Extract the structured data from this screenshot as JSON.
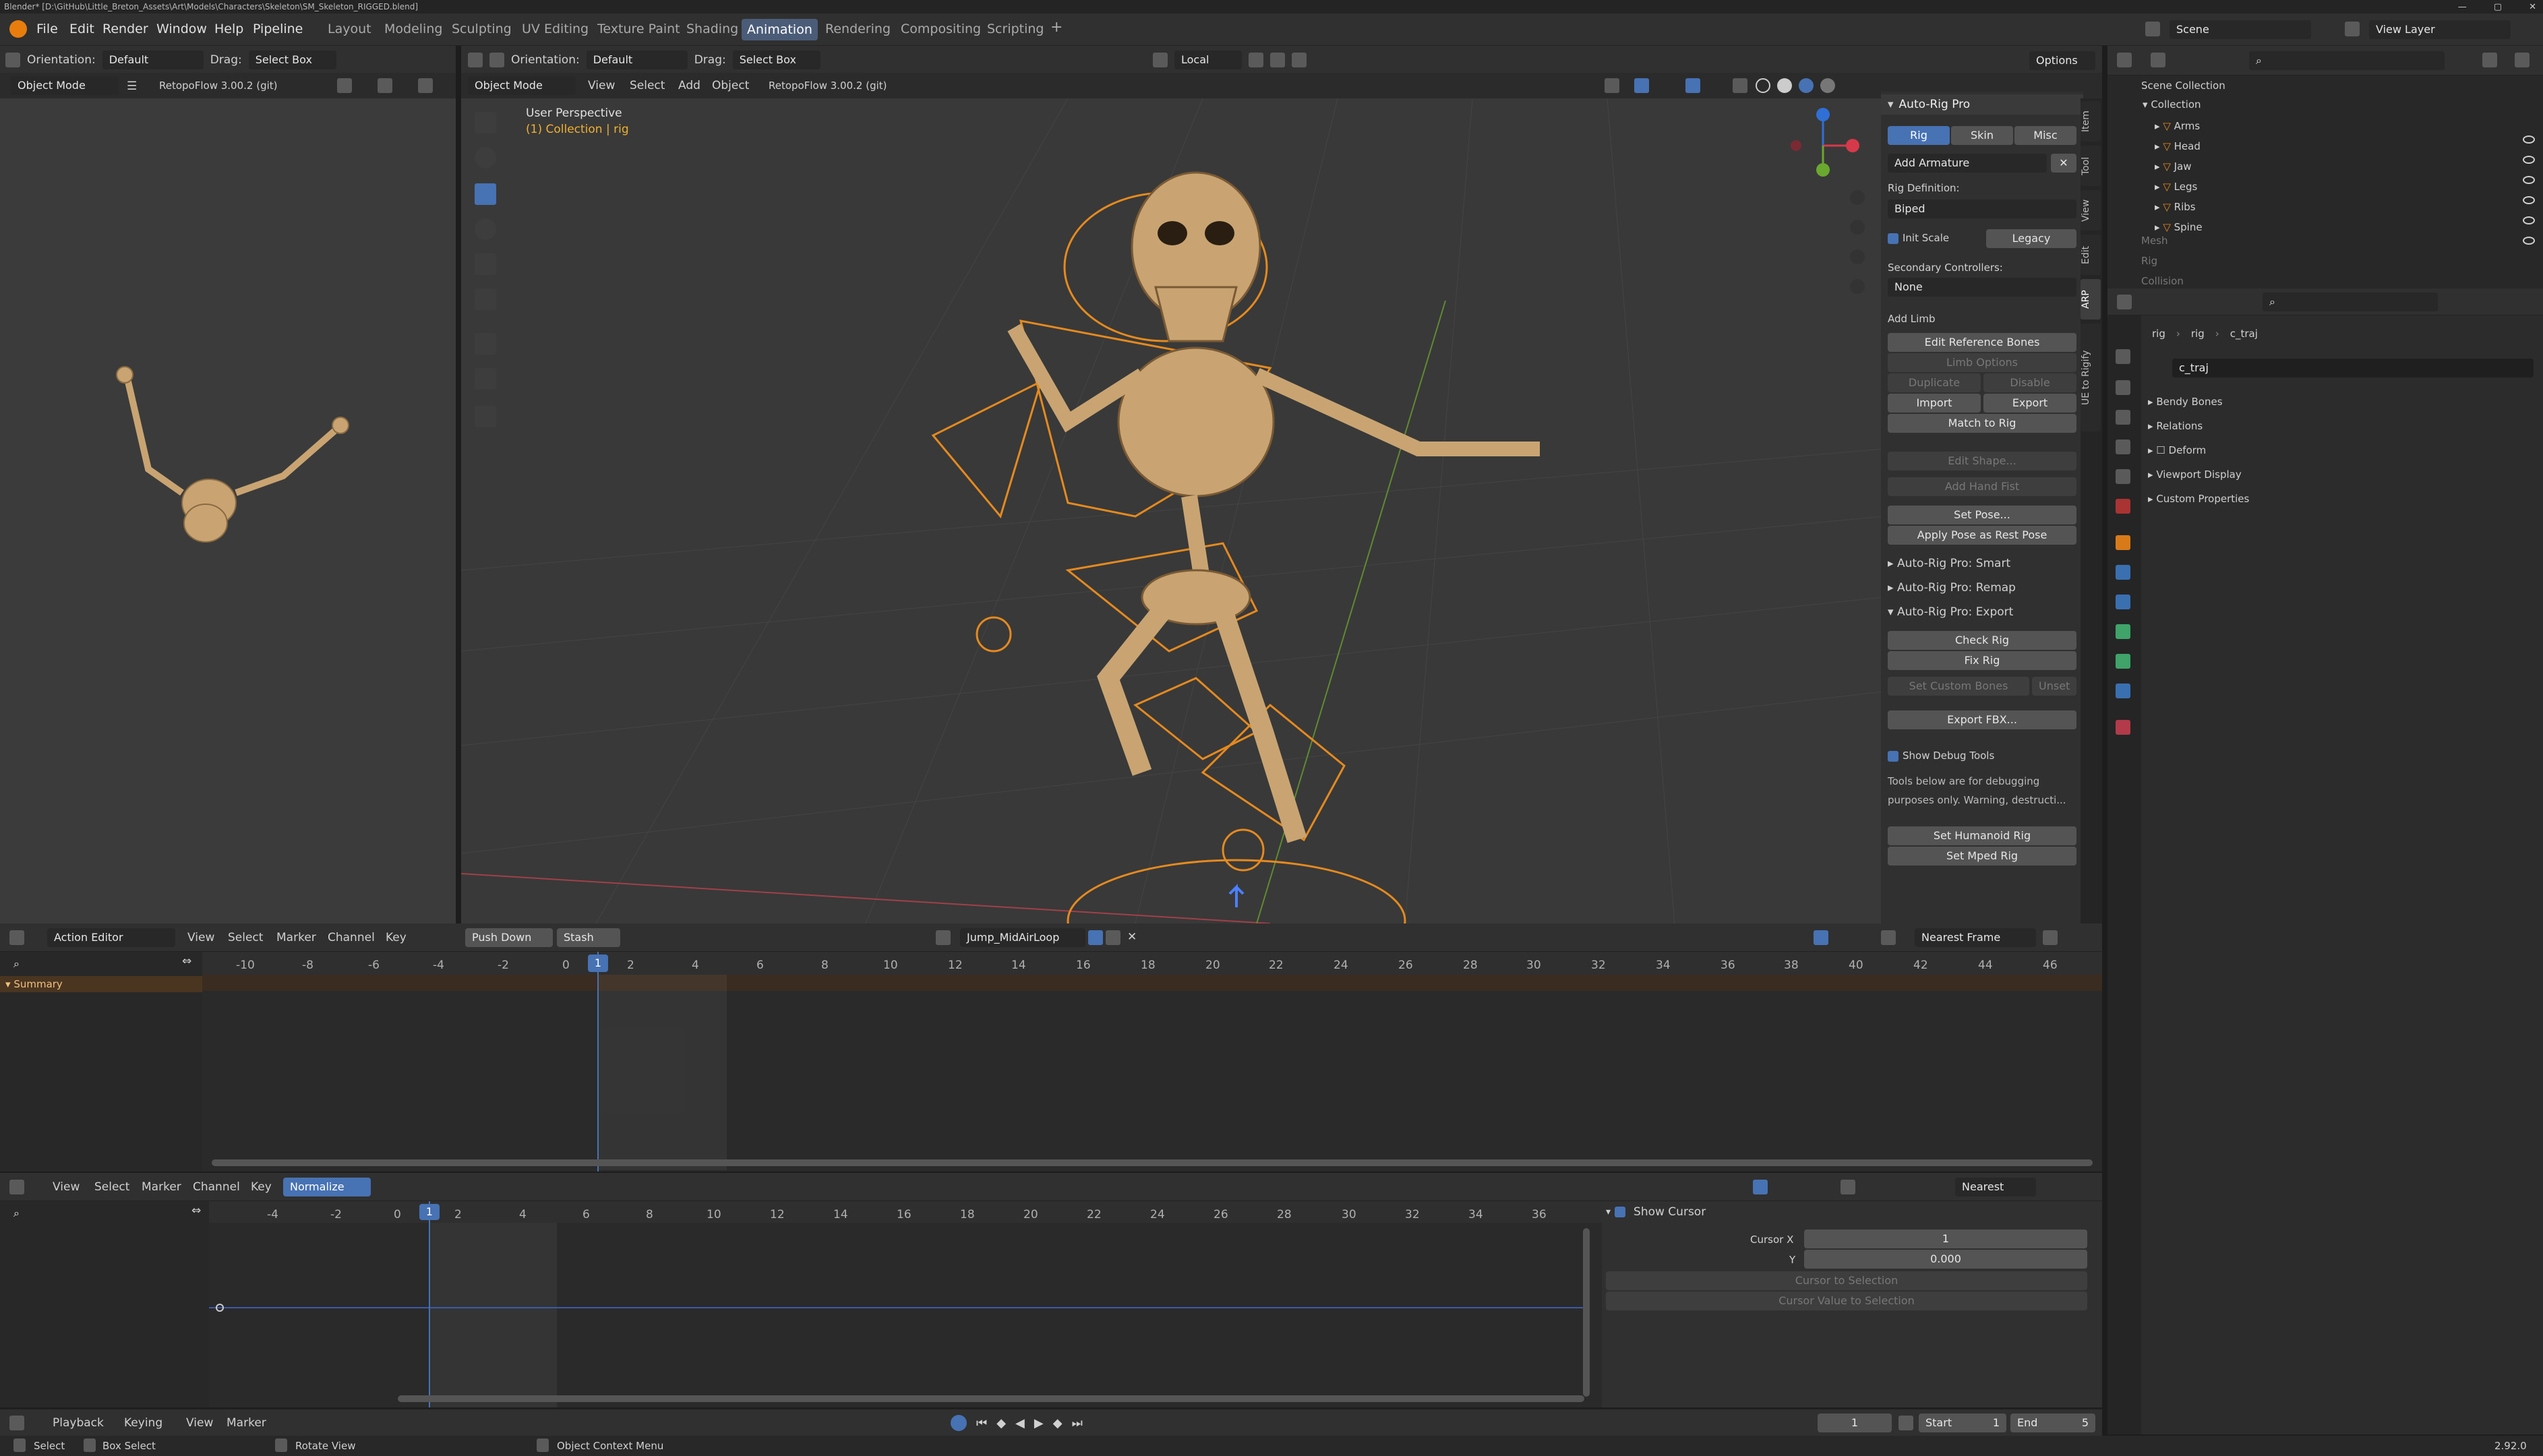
{
  "title_bar": "Blender* [D:\\GitHub\\Little_Breton_Assets\\Art\\Models\\Characters\\Skeleton\\SM_Skeleton_RIGGED.blend]",
  "menus": [
    "File",
    "Edit",
    "Render",
    "Window",
    "Help",
    "Pipeline"
  ],
  "workspaces": [
    "Layout",
    "Modeling",
    "Sculpting",
    "UV Editing",
    "Texture Paint",
    "Shading",
    "Animation",
    "Rendering",
    "Compositing",
    "Scripting"
  ],
  "active_workspace": "Animation",
  "scene_name": "Scene",
  "view_layer": "View Layer",
  "left_viewport": {
    "mode": "Object Mode",
    "addon": "RetopoFlow 3.00.2 (git)",
    "orientation_label": "Orientation:",
    "orientation": "Default",
    "drag_label": "Drag:",
    "drag": "Select Box"
  },
  "main_viewport": {
    "mode": "Object Mode",
    "menus": [
      "View",
      "Select",
      "Add",
      "Object"
    ],
    "addon": "RetopoFlow 3.00.2 (git)",
    "orientation_label": "Orientation:",
    "orientation": "Default",
    "drag_label": "Drag:",
    "drag": "Select Box",
    "transform": "Local",
    "options": "Options",
    "perspective": "User Perspective",
    "collection": "(1) Collection | rig"
  },
  "side_tabs": [
    "Item",
    "Tool",
    "View",
    "Edit",
    "ARP",
    "UE to Rigify"
  ],
  "arp": {
    "title": "Auto-Rig Pro",
    "tabs": [
      "Rig",
      "Skin",
      "Misc"
    ],
    "add_armature": "Add Armature",
    "rig_def_label": "Rig Definition:",
    "rig_def": "Biped",
    "init_scale": "Init Scale",
    "legacy": "Legacy",
    "secondary_label": "Secondary Controllers:",
    "secondary": "None",
    "add_limb": "Add Limb",
    "edit_ref": "Edit Reference Bones",
    "limb_options": "Limb Options",
    "duplicate": "Duplicate",
    "disable": "Disable",
    "import": "Import",
    "export": "Export",
    "match_to_rig": "Match to Rig",
    "edit_shape": "Edit Shape...",
    "add_hand_fist": "Add Hand Fist",
    "set_pose": "Set Pose...",
    "apply_pose": "Apply Pose as Rest Pose",
    "smart": "Auto-Rig Pro: Smart",
    "remap": "Auto-Rig Pro: Remap",
    "export_panel": "Auto-Rig Pro: Export",
    "check_rig": "Check Rig",
    "fix_rig": "Fix Rig",
    "set_custom_bones": "Set Custom Bones",
    "unset": "Unset",
    "export_fbx": "Export FBX...",
    "show_debug": "Show Debug Tools",
    "debug_text1": "Tools below are for debugging",
    "debug_text2": "purposes only. Warning, destructi...",
    "set_humanoid": "Set Humanoid Rig",
    "set_mped": "Set Mped Rig"
  },
  "outliner": {
    "root": "Scene Collection",
    "collection": "Collection",
    "items": [
      "Arms",
      "Head",
      "Jaw",
      "Legs",
      "Ribs",
      "Spine"
    ],
    "dim_items": [
      "Mesh",
      "Rig",
      "Collision"
    ]
  },
  "properties": {
    "crumbs": [
      "rig",
      "rig",
      "c_traj"
    ],
    "bone_name": "c_traj",
    "panels": [
      "Bendy Bones",
      "Relations",
      "Deform",
      "Viewport Display",
      "Custom Properties"
    ]
  },
  "action_editor": {
    "mode": "Action Editor",
    "menus": [
      "View",
      "Select",
      "Marker",
      "Channel",
      "Key"
    ],
    "push_down": "Push Down",
    "stash": "Stash",
    "action": "Jump_MidAirLoop",
    "snap": "Nearest Frame",
    "ticks": [
      "-10",
      "-8",
      "-6",
      "-4",
      "-2",
      "0",
      "2",
      "4",
      "6",
      "8",
      "10",
      "12",
      "14",
      "16",
      "18",
      "20",
      "22",
      "24",
      "26",
      "28",
      "30",
      "32",
      "34",
      "36",
      "38",
      "40",
      "42",
      "44",
      "46"
    ],
    "current": "1",
    "summary": "Summary"
  },
  "graph_editor": {
    "menus": [
      "View",
      "Select",
      "Marker",
      "Channel",
      "Key"
    ],
    "normalize": "Normalize",
    "snap": "Nearest Frame",
    "ticks": [
      "-4",
      "-2",
      "0",
      "2",
      "4",
      "6",
      "8",
      "10",
      "12",
      "14",
      "16",
      "18",
      "20",
      "22",
      "24",
      "26",
      "28",
      "30",
      "32",
      "34",
      "36"
    ],
    "current": "1",
    "show_cursor": "Show Cursor",
    "cursor_x_label": "Cursor X",
    "cursor_x": "1",
    "y_label": "Y",
    "y": "0.000",
    "cursor_to_sel": "Cursor to Selection",
    "cursor_val_sel": "Cursor Value to Selection"
  },
  "timeline": {
    "menus": [
      "Playback",
      "Keying",
      "View",
      "Marker"
    ],
    "frame": "1",
    "start_label": "Start",
    "start": "1",
    "end_label": "End",
    "end": "5"
  },
  "status": {
    "select": "Select",
    "box_select": "Box Select",
    "rotate": "Rotate View",
    "context": "Object Context Menu",
    "version": "2.92.0"
  },
  "colors": {
    "accent": "#4772b3",
    "rig_orange": "#e58a1f",
    "bone": "#c9a472"
  }
}
